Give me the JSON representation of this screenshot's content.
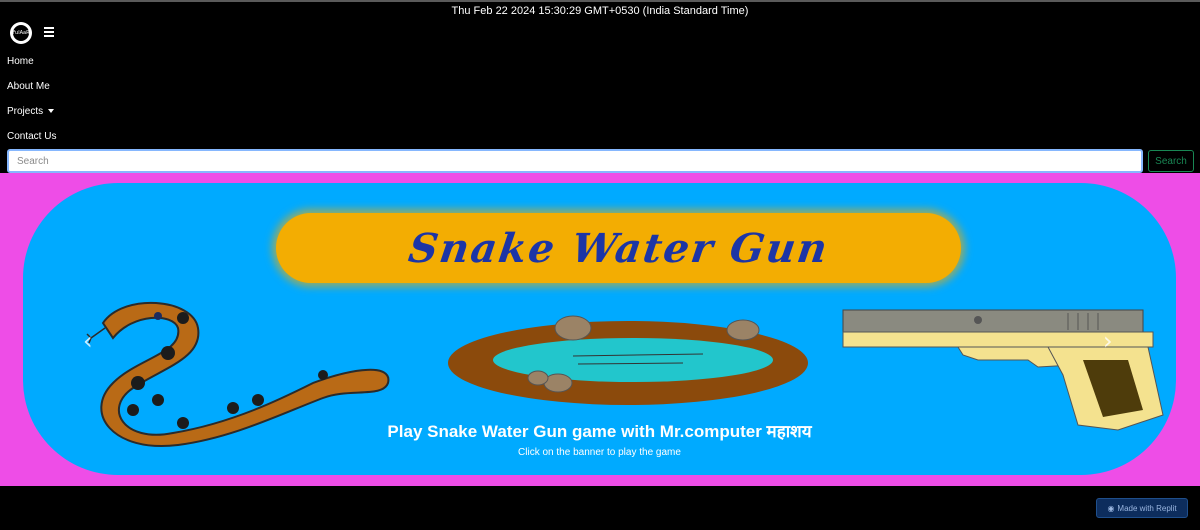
{
  "datetime": "Thu Feb 22 2024 15:30:29 GMT+0530 (India Standard Time)",
  "logo_text": "FulAaR",
  "nav": {
    "items": [
      {
        "label": "Home"
      },
      {
        "label": "About Me"
      },
      {
        "label": "Projects",
        "has_dropdown": true
      },
      {
        "label": "Contact Us"
      }
    ]
  },
  "search": {
    "placeholder": "Search",
    "value": "",
    "button_label": "Search"
  },
  "carousel": {
    "banner_title": "Snake Water Gun",
    "caption_title": "Play Snake Water Gun game with Mr.computer महाशय",
    "caption_sub": "Click on the banner to play the game",
    "prev_icon": "chevron-left-icon",
    "next_icon": "chevron-right-icon",
    "slides": 4,
    "active_slide": 1
  },
  "badge": {
    "label": "Made with Replit"
  },
  "colors": {
    "hero_bg": "#ee4de7",
    "banner_bg": "#00aaff",
    "title_pill": "#f3ad02",
    "title_text": "#1c35a6",
    "search_button": "#198754"
  }
}
